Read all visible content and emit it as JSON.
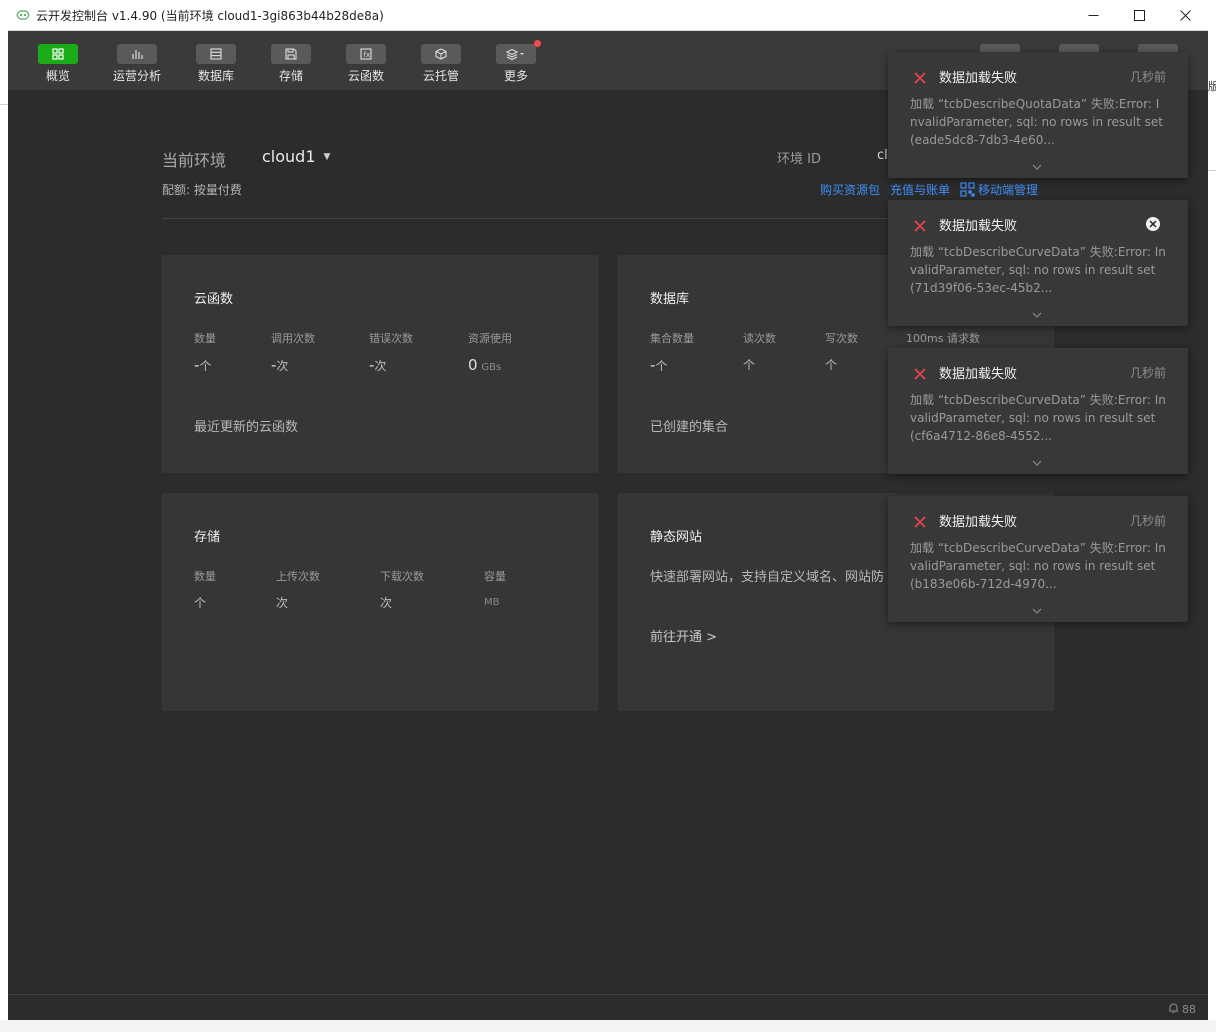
{
  "window": {
    "title": "云开发控制台 v1.4.90  (当前环境 cloud1-3gi863b44b28de8a)",
    "controls": {
      "minimize": "—",
      "maximize": "☐",
      "close": "✕"
    }
  },
  "toolbar": {
    "items": [
      {
        "label": "概览",
        "icon": "grid-icon",
        "active": true
      },
      {
        "label": "运营分析",
        "icon": "bar-chart-icon"
      },
      {
        "label": "数据库",
        "icon": "database-icon"
      },
      {
        "label": "存储",
        "icon": "storage-icon"
      },
      {
        "label": "云函数",
        "icon": "function-icon"
      },
      {
        "label": "云托管",
        "icon": "cube-icon"
      },
      {
        "label": "更多",
        "icon": "layers-icon",
        "badge": true
      }
    ]
  },
  "env": {
    "label": "当前环境",
    "value": "cloud1",
    "id_label": "环境 ID",
    "id_value": "cloud1-3gi863b44b28de8a",
    "quota": "配额: 按量付费",
    "links": [
      "购买资源包",
      "充值与账单",
      "移动端管理"
    ]
  },
  "cards": {
    "functions": {
      "title": "云函数",
      "stats": [
        {
          "label": "数量",
          "value": "-",
          "unit": "个"
        },
        {
          "label": "调用次数",
          "value": "-",
          "unit": "次"
        },
        {
          "label": "错误次数",
          "value": "-",
          "unit": "次"
        },
        {
          "label": "资源使用",
          "value": "0",
          "unit": "GBs"
        }
      ],
      "sub": "最近更新的云函数"
    },
    "database": {
      "title": "数据库",
      "stats": [
        {
          "label": "集合数量",
          "value": "-",
          "unit": "个"
        },
        {
          "label": "读次数",
          "value": "",
          "unit": "个"
        },
        {
          "label": "写次数",
          "value": "",
          "unit": "个"
        },
        {
          "label": "100ms 请求数",
          "value": "",
          "unit": ""
        }
      ],
      "sub": "已创建的集合"
    },
    "storage": {
      "title": "存储",
      "stats": [
        {
          "label": "数量",
          "value": "",
          "unit": "个"
        },
        {
          "label": "上传次数",
          "value": "",
          "unit": "次"
        },
        {
          "label": "下载次数",
          "value": "",
          "unit": "次"
        },
        {
          "label": "容量",
          "value": "",
          "unit": "MB"
        }
      ]
    },
    "static": {
      "title": "静态网站",
      "desc": "快速部署网站，支持自定义域名、网站防",
      "action": "前往开通 >"
    }
  },
  "notifications": [
    {
      "title": "数据加载失败",
      "time": "几秒前",
      "body": "加载 “tcbDescribeQuotaData” 失败:Error: InvalidParameter, sql: no rows in result set (eade5dc8-7db3-4e60...",
      "show_close": false
    },
    {
      "title": "数据加载失败",
      "time": "",
      "body": "加载 “tcbDescribeCurveData” 失败:Error: InvalidParameter, sql: no rows in result set (71d39f06-53ec-45b2...",
      "show_close": true
    },
    {
      "title": "数据加载失败",
      "time": "几秒前",
      "body": "加载 “tcbDescribeCurveData” 失败:Error: InvalidParameter, sql: no rows in result set (cf6a4712-86e8-4552...",
      "show_close": false
    },
    {
      "title": "数据加载失败",
      "time": "几秒前",
      "body": "加载 “tcbDescribeCurveData” 失败:Error: InvalidParameter, sql: no rows in result set (b183e06b-712d-4970...",
      "show_close": false
    }
  ],
  "statusbar": {
    "notification_count": "88"
  },
  "edge_fragment": "版"
}
